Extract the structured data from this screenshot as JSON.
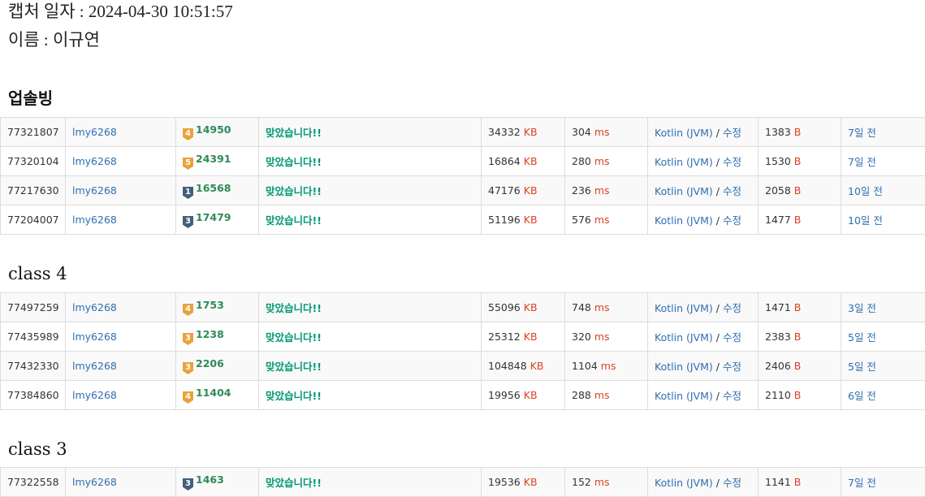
{
  "header": {
    "capture_line": "캡처 일자 : 2024-04-30 10:51:57",
    "name_line": "이름 : 이규연"
  },
  "sections": [
    {
      "title": "업솔빙",
      "rows": [
        {
          "id": "77321807",
          "user": "lmy6268",
          "tier": "4",
          "tier_color": "#e9a23b",
          "problem": "14950",
          "result": "맞았습니다!!",
          "memory": "34332",
          "memory_unit": "KB",
          "time": "304",
          "time_unit": "ms",
          "language": "Kotlin (JVM)",
          "separator": "/",
          "edit": "수정",
          "length": "1383",
          "length_unit": "B",
          "submitted": "7일 전"
        },
        {
          "id": "77320104",
          "user": "lmy6268",
          "tier": "5",
          "tier_color": "#e9a23b",
          "problem": "24391",
          "result": "맞았습니다!!",
          "memory": "16864",
          "memory_unit": "KB",
          "time": "280",
          "time_unit": "ms",
          "language": "Kotlin (JVM)",
          "separator": "/",
          "edit": "수정",
          "length": "1530",
          "length_unit": "B",
          "submitted": "7일 전"
        },
        {
          "id": "77217630",
          "user": "lmy6268",
          "tier": "1",
          "tier_color": "#435f7a",
          "problem": "16568",
          "result": "맞았습니다!!",
          "memory": "47176",
          "memory_unit": "KB",
          "time": "236",
          "time_unit": "ms",
          "language": "Kotlin (JVM)",
          "separator": "/",
          "edit": "수정",
          "length": "2058",
          "length_unit": "B",
          "submitted": "10일 전"
        },
        {
          "id": "77204007",
          "user": "lmy6268",
          "tier": "3",
          "tier_color": "#435f7a",
          "problem": "17479",
          "result": "맞았습니다!!",
          "memory": "51196",
          "memory_unit": "KB",
          "time": "576",
          "time_unit": "ms",
          "language": "Kotlin (JVM)",
          "separator": "/",
          "edit": "수정",
          "length": "1477",
          "length_unit": "B",
          "submitted": "10일 전"
        }
      ]
    },
    {
      "title": "class 4",
      "rows": [
        {
          "id": "77497259",
          "user": "lmy6268",
          "tier": "4",
          "tier_color": "#e9a23b",
          "problem": "1753",
          "result": "맞았습니다!!",
          "memory": "55096",
          "memory_unit": "KB",
          "time": "748",
          "time_unit": "ms",
          "language": "Kotlin (JVM)",
          "separator": "/",
          "edit": "수정",
          "length": "1471",
          "length_unit": "B",
          "submitted": "3일 전"
        },
        {
          "id": "77435989",
          "user": "lmy6268",
          "tier": "3",
          "tier_color": "#e9a23b",
          "problem": "1238",
          "result": "맞았습니다!!",
          "memory": "25312",
          "memory_unit": "KB",
          "time": "320",
          "time_unit": "ms",
          "language": "Kotlin (JVM)",
          "separator": "/",
          "edit": "수정",
          "length": "2383",
          "length_unit": "B",
          "submitted": "5일 전"
        },
        {
          "id": "77432330",
          "user": "lmy6268",
          "tier": "3",
          "tier_color": "#e9a23b",
          "problem": "2206",
          "result": "맞았습니다!!",
          "memory": "104848",
          "memory_unit": "KB",
          "time": "1104",
          "time_unit": "ms",
          "language": "Kotlin (JVM)",
          "separator": "/",
          "edit": "수정",
          "length": "2406",
          "length_unit": "B",
          "submitted": "5일 전"
        },
        {
          "id": "77384860",
          "user": "lmy6268",
          "tier": "4",
          "tier_color": "#e9a23b",
          "problem": "11404",
          "result": "맞았습니다!!",
          "memory": "19956",
          "memory_unit": "KB",
          "time": "288",
          "time_unit": "ms",
          "language": "Kotlin (JVM)",
          "separator": "/",
          "edit": "수정",
          "length": "2110",
          "length_unit": "B",
          "submitted": "6일 전"
        }
      ]
    },
    {
      "title": "class 3",
      "rows": [
        {
          "id": "77322558",
          "user": "lmy6268",
          "tier": "3",
          "tier_color": "#435f7a",
          "problem": "1463",
          "result": "맞았습니다!!",
          "memory": "19536",
          "memory_unit": "KB",
          "time": "152",
          "time_unit": "ms",
          "language": "Kotlin (JVM)",
          "separator": "/",
          "edit": "수정",
          "length": "1141",
          "length_unit": "B",
          "submitted": "7일 전"
        }
      ]
    }
  ]
}
